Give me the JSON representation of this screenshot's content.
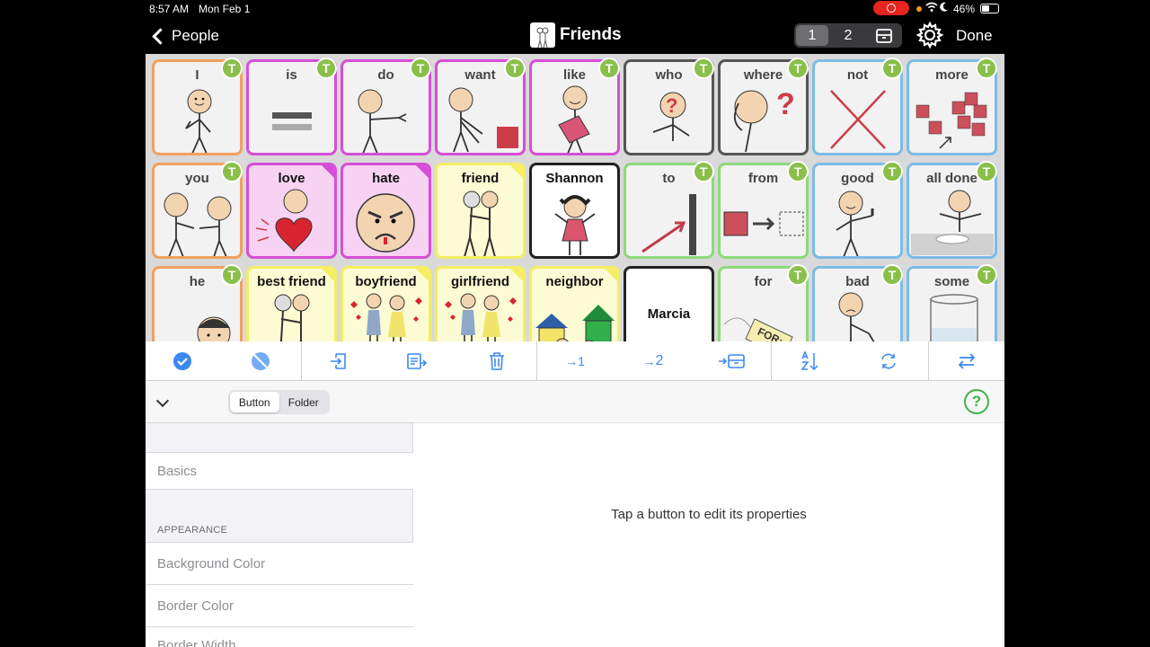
{
  "status_bar": {
    "time": "8:57 AM",
    "date": "Mon Feb 1",
    "battery": "46%"
  },
  "nav": {
    "back_label": "People",
    "title": "Friends",
    "pages": [
      "1",
      "2"
    ],
    "selected_page": "1",
    "done_label": "Done"
  },
  "grid": {
    "badge": "T",
    "buttons": [
      {
        "label": "I",
        "border": "#f2a05e",
        "bg": "#f2f2f2",
        "pic": "person-point-self",
        "badge": true
      },
      {
        "label": "is",
        "border": "#d84dd8",
        "bg": "#f2f2f2",
        "pic": "equals",
        "badge": true
      },
      {
        "label": "do",
        "border": "#d84dd8",
        "bg": "#f2f2f2",
        "pic": "person-do",
        "badge": true
      },
      {
        "label": "want",
        "border": "#d84dd8",
        "bg": "#f2f2f2",
        "pic": "person-want",
        "badge": true
      },
      {
        "label": "like",
        "border": "#d84dd8",
        "bg": "#f2f2f2",
        "pic": "person-like",
        "badge": true
      },
      {
        "label": "who",
        "border": "#555555",
        "bg": "#f2f2f2",
        "pic": "person-who",
        "badge": true
      },
      {
        "label": "where",
        "border": "#555555",
        "bg": "#f2f2f2",
        "pic": "person-where",
        "badge": true
      },
      {
        "label": "not",
        "border": "#7cbce6",
        "bg": "#f2f2f2",
        "pic": "cross",
        "badge": true
      },
      {
        "label": "more",
        "border": "#7cbce6",
        "bg": "#f2f2f2",
        "pic": "squares",
        "badge": true
      },
      {
        "label": "you",
        "border": "#f2a05e",
        "bg": "#f2f2f2",
        "pic": "two-people",
        "badge": true
      },
      {
        "label": "love",
        "border": "#d84dd8",
        "bg": "#f7d2f2",
        "pic": "heart",
        "badge": false,
        "corner": "#d84dd8"
      },
      {
        "label": "hate",
        "border": "#d84dd8",
        "bg": "#f7d2f2",
        "pic": "angry-face",
        "badge": false,
        "corner": "#d84dd8"
      },
      {
        "label": "friend",
        "border": "#f4ee62",
        "bg": "#fdfbd3",
        "pic": "friends",
        "badge": false,
        "corner": "#f4ee62"
      },
      {
        "label": "Shannon",
        "border": "#222222",
        "bg": "#ffffff",
        "pic": "girl",
        "badge": false
      },
      {
        "label": "to",
        "border": "#8ed97a",
        "bg": "#f2f2f2",
        "pic": "arrow-to",
        "badge": true
      },
      {
        "label": "from",
        "border": "#8ed97a",
        "bg": "#f2f2f2",
        "pic": "arrow-from",
        "badge": true
      },
      {
        "label": "good",
        "border": "#7cbce6",
        "bg": "#f2f2f2",
        "pic": "thumbs-up",
        "badge": true
      },
      {
        "label": "all done",
        "border": "#7cbce6",
        "bg": "#f2f2f2",
        "pic": "all-done",
        "badge": true
      },
      {
        "label": "he",
        "border": "#f2a05e",
        "bg": "#f2f2f2",
        "pic": "boy",
        "badge": true
      },
      {
        "label": "best friend",
        "border": "#f4ee62",
        "bg": "#fdfbd3",
        "pic": "friends",
        "badge": false,
        "corner": "#f4ee62"
      },
      {
        "label": "boyfriend",
        "border": "#f4ee62",
        "bg": "#fdfbd3",
        "pic": "couple",
        "badge": false,
        "corner": "#f4ee62"
      },
      {
        "label": "girlfriend",
        "border": "#f4ee62",
        "bg": "#fdfbd3",
        "pic": "couple",
        "badge": false,
        "corner": "#f4ee62"
      },
      {
        "label": "neighbor",
        "border": "#f4ee62",
        "bg": "#fdfbd3",
        "pic": "houses",
        "badge": false,
        "corner": "#f4ee62"
      },
      {
        "label": "",
        "center_label": "Marcia",
        "border": "#222222",
        "bg": "#ffffff",
        "pic": "none",
        "badge": false
      },
      {
        "label": "for",
        "border": "#8ed97a",
        "bg": "#f2f2f2",
        "pic": "tag",
        "badge": true
      },
      {
        "label": "bad",
        "border": "#7cbce6",
        "bg": "#f2f2f2",
        "pic": "person-bad",
        "badge": true
      },
      {
        "label": "some",
        "border": "#7cbce6",
        "bg": "#f2f2f2",
        "pic": "glass",
        "badge": true
      }
    ]
  },
  "toolbar": {
    "icons": [
      "select-all-icon",
      "deselect-icon",
      "import-icon",
      "paste-icon",
      "trash-icon",
      "move-to-page-1-icon",
      "move-to-page-2-icon",
      "move-to-archive-icon",
      "sort-icon",
      "refresh-icon",
      "swap-icon"
    ],
    "page1": "1",
    "page2": "2"
  },
  "editor": {
    "type_options": [
      "Button",
      "Folder"
    ],
    "selected_type": "Button",
    "basics_label": "Basics",
    "appearance_header": "APPEARANCE",
    "rows": [
      "Background Color",
      "Border Color",
      "Border Width"
    ],
    "hint": "Tap a button to edit its properties",
    "help_label": "?"
  },
  "colors": {
    "accent": "#3b88f4",
    "badge_green": "#8ac04a",
    "help_green": "#3bb54a",
    "record_red": "#e5251e"
  }
}
